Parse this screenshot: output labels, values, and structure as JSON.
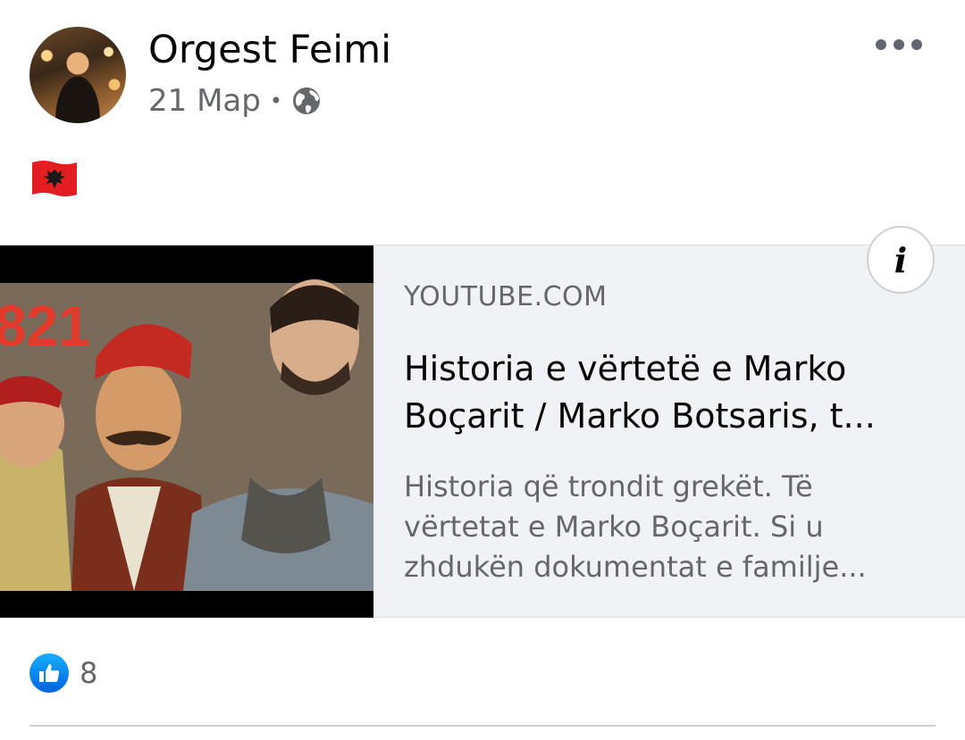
{
  "post": {
    "author": "Orgest Feimi",
    "date": "21 Мар",
    "separator": "•",
    "privacy_icon": "globe-icon",
    "text_emoji": "albania-flag"
  },
  "link_preview": {
    "domain": "YOUTUBE.COM",
    "title": "Historia e vërtetë e Marko Boçarit / Marko Botsaris, t...",
    "description": "Historia që trondit grekët. Të vërtetat e Marko Boçarit. Si u zhdukën dokumentat e familje...",
    "thumbnail_caption": "821",
    "info_icon_label": "i"
  },
  "reactions": {
    "icon": "like-icon",
    "count": "8"
  },
  "colors": {
    "primary_text": "#050505",
    "secondary_text": "#65676b",
    "card_background": "#f0f2f5",
    "like_blue": "#1877f2",
    "flag_red": "#e41e20"
  }
}
